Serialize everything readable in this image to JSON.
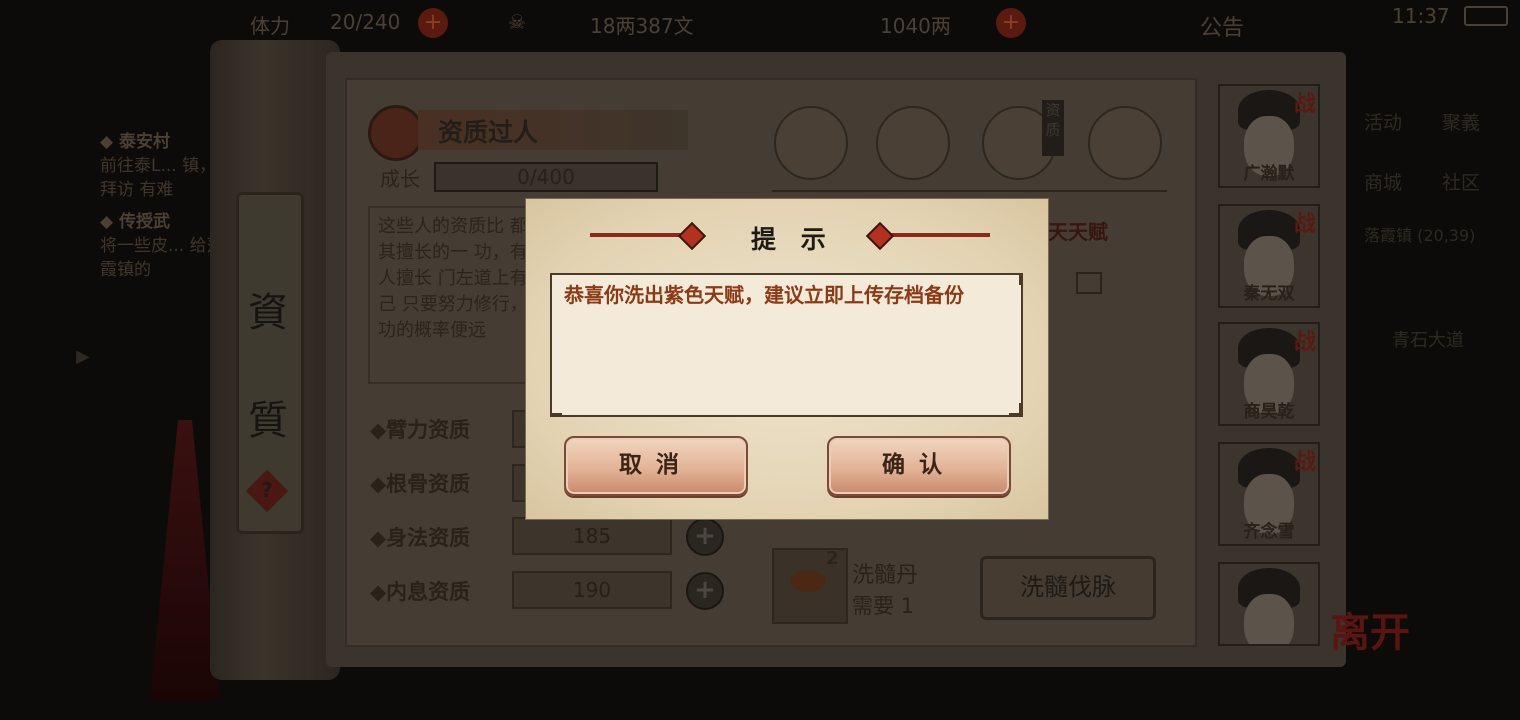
{
  "topbar": {
    "stamina": "20/240",
    "silver": "18两387文",
    "gold": "1040两",
    "notice": "公告",
    "clock": "11:37"
  },
  "quest": {
    "item1_title": "◆ 泰安村",
    "item1_text": "前往泰L... 镇，拜访 有难",
    "item2_title": "◆ 传授武",
    "item2_text": "将一些皮... 给落霞镇的"
  },
  "scroll": {
    "char1": "資",
    "char2": "質",
    "help": "?"
  },
  "talent": {
    "title": "资质过人",
    "growth_label": "成长",
    "growth_value": "0/400",
    "description": "这些人的资质比 都有其擅长的一 功，有些人擅长 门左道上有自己 只要努力修行， 成功的概率便远",
    "tab_icon_badge": "资质",
    "right_header": "天天赋"
  },
  "attributes": [
    {
      "label": "◆臂力资质",
      "value": ""
    },
    {
      "label": "◆根骨资质",
      "value": ""
    },
    {
      "label": "◆身法资质",
      "value": "185"
    },
    {
      "label": "◆内息资质",
      "value": "190"
    }
  ],
  "item": {
    "count": "2",
    "name": "洗髓丹",
    "need": "需要  1",
    "action": "洗髓伐脉"
  },
  "characters": [
    {
      "name": "广瀚默",
      "tag": "战"
    },
    {
      "name": "秦无双",
      "tag": "战"
    },
    {
      "name": "商昊乾",
      "tag": "战"
    },
    {
      "name": "齐念雪",
      "tag": "战"
    },
    {
      "name": "",
      "tag": ""
    }
  ],
  "right_menu": {
    "m1": "活动",
    "m2": "聚義",
    "m3": "商城",
    "m4": "社区",
    "location": "落霞镇 (20,39)",
    "road": "青石大道"
  },
  "dialog": {
    "title": "提 示",
    "message": "恭喜你洗出紫色天赋，建议立即上传存档备份",
    "cancel": "取消",
    "confirm": "确认"
  },
  "logo": "离开",
  "colors": {
    "dialog_bg": "#efe4cd",
    "message_text": "#8b3a16",
    "button": "#e3b397"
  }
}
